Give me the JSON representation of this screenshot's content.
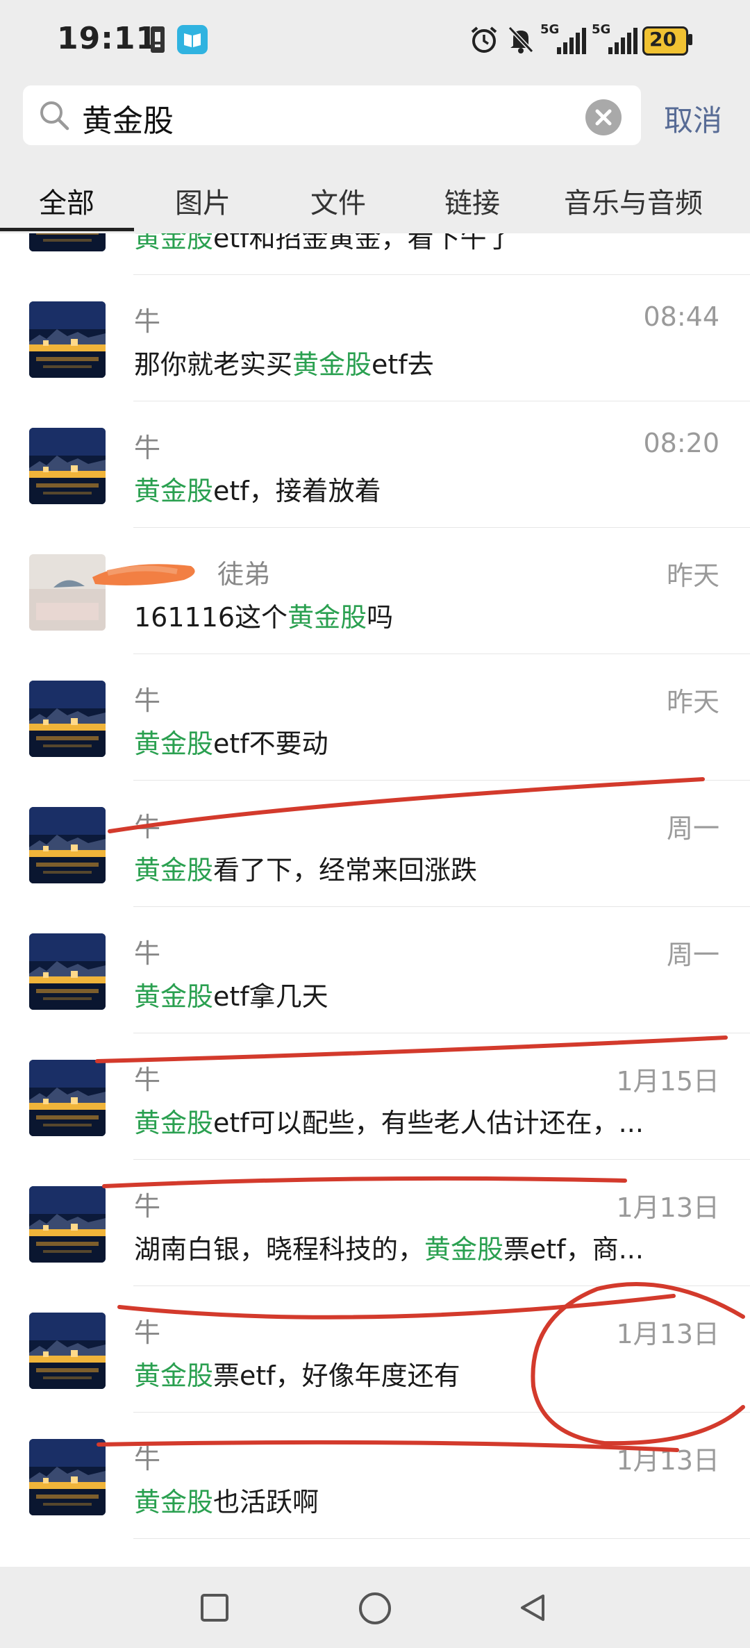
{
  "status_bar": {
    "time": "19:11",
    "signal_1_label": "5G",
    "signal_2_label": "5G",
    "battery": "20"
  },
  "search": {
    "query": "黄金股",
    "cancel_label": "取消"
  },
  "tabs": [
    "全部",
    "图片",
    "文件",
    "链接",
    "音乐与音频"
  ],
  "results": [
    {
      "name": "",
      "time": "",
      "pre": "",
      "hl": "黄金股",
      "post": "etf和招金黄金，看下午了",
      "avatar": "night-city"
    },
    {
      "name": "牛",
      "time": "08:44",
      "pre": "那你就老实买",
      "hl": "黄金股",
      "post": "etf去",
      "avatar": "night-city"
    },
    {
      "name": "牛",
      "time": "08:20",
      "pre": "",
      "hl": "黄金股",
      "post": "etf，接着放着",
      "avatar": "night-city"
    },
    {
      "name": "徒弟",
      "time": "昨天",
      "pre": "161116这个",
      "hl": "黄金股",
      "post": "吗",
      "avatar": "landscape"
    },
    {
      "name": "牛",
      "time": "昨天",
      "pre": "",
      "hl": "黄金股",
      "post": "etf不要动",
      "avatar": "night-city"
    },
    {
      "name": "牛",
      "time": "周一",
      "pre": "",
      "hl": "黄金股",
      "post": "看了下，经常来回涨跌",
      "avatar": "night-city"
    },
    {
      "name": "牛",
      "time": "周一",
      "pre": "",
      "hl": "黄金股",
      "post": "etf拿几天",
      "avatar": "night-city"
    },
    {
      "name": "牛",
      "time": "1月15日",
      "pre": "",
      "hl": "黄金股",
      "post": "etf可以配些，有些老人估计还在，...",
      "avatar": "night-city"
    },
    {
      "name": "牛",
      "time": "1月13日",
      "pre": "湖南白银，晓程科技的，",
      "hl": "黄金股",
      "post": "票etf，商...",
      "avatar": "night-city"
    },
    {
      "name": "牛",
      "time": "1月13日",
      "pre": "",
      "hl": "黄金股",
      "post": "票etf，好像年度还有",
      "avatar": "night-city"
    },
    {
      "name": "牛",
      "time": "1月13日",
      "pre": "",
      "hl": "黄金股",
      "post": "也活跃啊",
      "avatar": "night-city"
    }
  ],
  "colors": {
    "highlight": "#2aa050",
    "link": "#576b95",
    "annotation": "#d33a2c"
  },
  "icons": [
    "alarm-icon",
    "mute-icon",
    "signal-icon",
    "battery-icon",
    "search-icon",
    "clear-icon",
    "recents-icon",
    "home-icon",
    "back-icon"
  ]
}
